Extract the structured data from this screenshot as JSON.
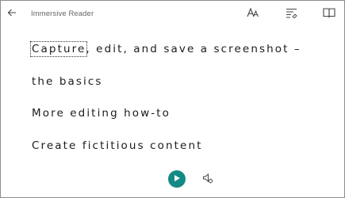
{
  "header": {
    "title": "Immersive Reader",
    "back_icon": "back-arrow-icon",
    "toolbar": [
      {
        "name": "text-preferences",
        "icon": "text-size-icon"
      },
      {
        "name": "grammar-options",
        "icon": "grammar-options-icon"
      },
      {
        "name": "reading-preferences",
        "icon": "book-open-icon"
      }
    ]
  },
  "content": {
    "line1_word": "Capture",
    "line1_rest": ", edit, and save a screenshot –",
    "line2": "the basics",
    "line3": "More editing how-to",
    "line4": "Create fictitious content"
  },
  "playback": {
    "play_icon": "play-icon",
    "voice_icon": "voice-settings-icon"
  },
  "colors": {
    "accent": "#138a84",
    "text": "#1b1b1b",
    "title_text": "#666666"
  }
}
